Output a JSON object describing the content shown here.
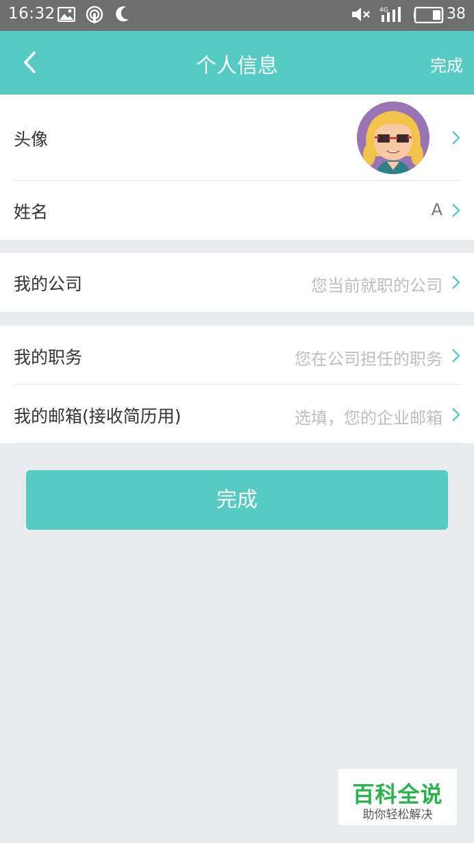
{
  "status_bar": {
    "time": "16:32",
    "network": "4G",
    "battery": "38"
  },
  "header": {
    "title": "个人信息",
    "done_label": "完成"
  },
  "profile": {
    "avatar_label": "头像",
    "name_label": "姓名",
    "name_value": "A"
  },
  "company": {
    "label": "我的公司",
    "placeholder": "您当前就职的公司"
  },
  "job": {
    "position_label": "我的职务",
    "position_placeholder": "您在公司担任的职务",
    "email_label": "我的邮箱(接收简历用)",
    "email_placeholder": "选填，您的企业邮箱"
  },
  "submit_label": "完成",
  "watermark": {
    "title": "百科全说",
    "subtitle": "助你轻松解决"
  },
  "colors": {
    "accent": "#55cbc3",
    "status_bar": "#6e6e6e",
    "background": "#e8eced",
    "watermark_green": "#27b34a"
  },
  "icons": [
    "back-arrow-icon",
    "chevron-right-icon",
    "gallery-icon",
    "hotspot-icon",
    "moon-icon",
    "mute-icon",
    "signal-icon",
    "battery-icon"
  ]
}
